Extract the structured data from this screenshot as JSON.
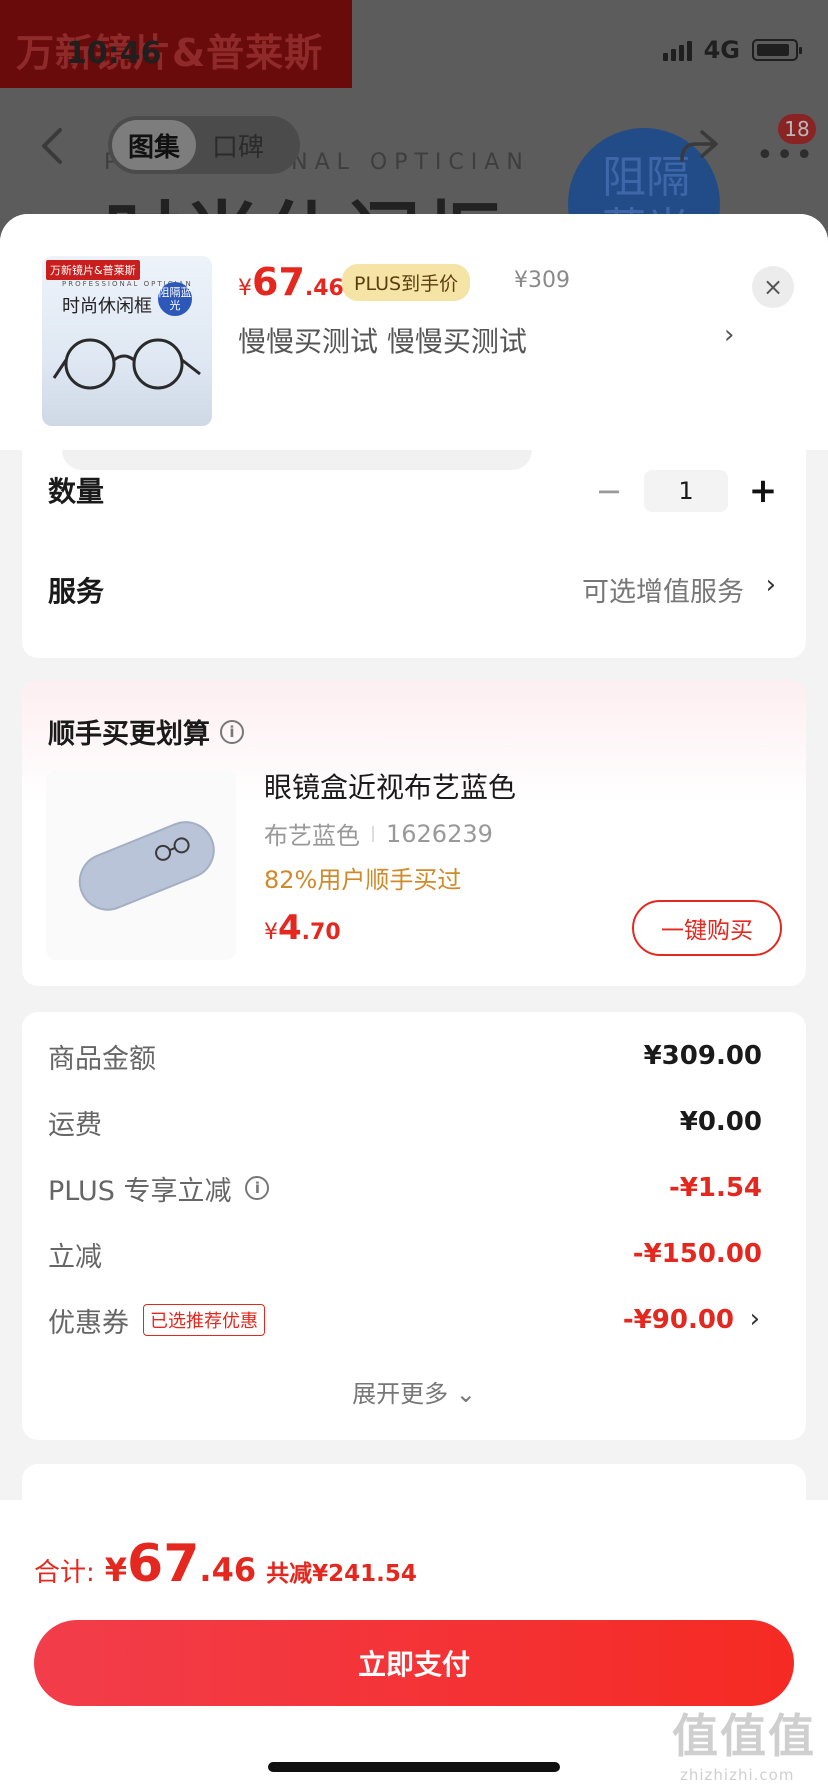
{
  "status_bar": {
    "time": "10:46",
    "network": "4G"
  },
  "background": {
    "brand_text": "万新镜片&普莱斯",
    "tabs": [
      "图集",
      "口碑"
    ],
    "banner_sub": "PROFESSIONAL OPTICIAN",
    "banner_title": "时尚休闲框",
    "badge_text": "阻隔蓝光",
    "cart_count": "18"
  },
  "header": {
    "thumb": {
      "brand": "万新镜片&普莱斯",
      "sub": "PROFESSIONAL OPTICIAN",
      "title": "时尚休闲框",
      "badge": "阻隔蓝光"
    },
    "price_currency": "¥",
    "price_int": "67",
    "price_dec": ".46",
    "plus_tag": "PLUS到手价",
    "original_price": "¥309",
    "spec": "慢慢买测试  慢慢买测试",
    "spec_arrow": "›",
    "close": "×"
  },
  "quantity_card": {
    "qty_label": "数量",
    "qty_minus": "−",
    "qty_value": "1",
    "qty_plus": "+",
    "service_label": "服务",
    "service_value": "可选增值服务",
    "service_arrow": "›"
  },
  "addon_card": {
    "title": "顺手买更划算",
    "info": "i",
    "product_name": "眼镜盒近视布艺蓝色",
    "spec_color": "布艺蓝色",
    "spec_id": "1626239",
    "buy_rate": "82%用户顺手买过",
    "price_currency": "¥",
    "price_int": "4",
    "price_dec": ".70",
    "buy_button": "一键购买"
  },
  "summary_card": {
    "rows": [
      {
        "label": "商品金额",
        "amount": "¥309.00"
      },
      {
        "label": "运费",
        "amount": "¥0.00"
      },
      {
        "label": "PLUS 专享立减",
        "amount": "-¥1.54"
      },
      {
        "label": "立减",
        "amount": "-¥150.00"
      },
      {
        "label": "优惠券",
        "tag": "已选推荐优惠",
        "amount": "-¥90.00"
      }
    ],
    "info": "i",
    "coupon_arrow": "›",
    "expand": "展开更多 ⌄"
  },
  "bottom_bar": {
    "total_label": "合计:",
    "total_currency": "¥",
    "total_int": "67",
    "total_dec": ".46",
    "saved": "共减¥241.54",
    "pay_button": "立即支付"
  },
  "watermark": {
    "main": "值值值",
    "sub": "zhizhizhi.com"
  },
  "colors": {
    "accent_red": "#e4281f",
    "plus_gold": "#f6e3a6",
    "rate_orange": "#d08a2a"
  }
}
